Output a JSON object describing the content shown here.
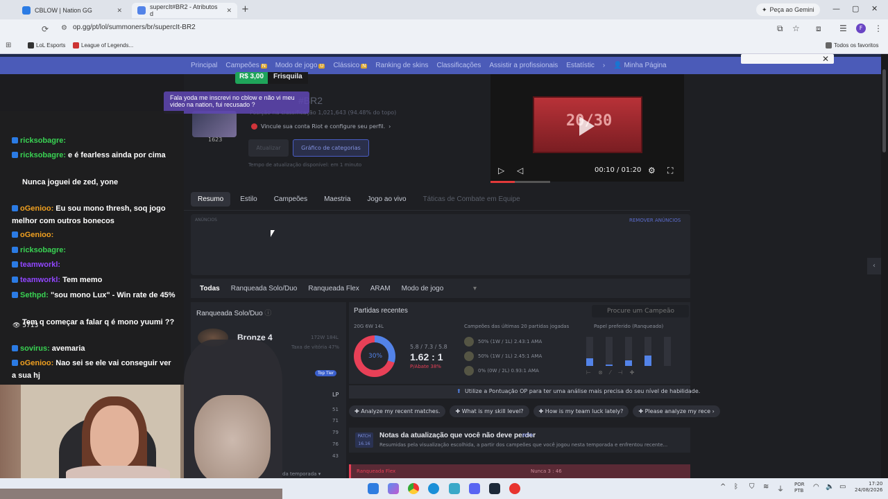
{
  "browser": {
    "tabs": [
      {
        "title": "CBLOW | Nation GG"
      },
      {
        "title": "supercIt#BR2 - Atributos d"
      }
    ],
    "new_tab": "+",
    "gemini_button": "Peça ao Gemini",
    "url": "op.gg/pt/lol/summoners/br/supercIt-BR2",
    "bookmarks": [
      "LoL Esports",
      "League of Legends..."
    ],
    "all_favorites": "Todos os favoritos",
    "profile_initial": "F"
  },
  "site_nav": {
    "items": [
      {
        "label": "Principal",
        "badge": ""
      },
      {
        "label": "Campeões",
        "badge": "N"
      },
      {
        "label": "Modo de jogo",
        "badge": "U"
      },
      {
        "label": "Clássico",
        "badge": "N"
      },
      {
        "label": "Ranking de skins",
        "badge": ""
      },
      {
        "label": "Classificações",
        "badge": ""
      },
      {
        "label": "Assistir a profissionais",
        "badge": ""
      },
      {
        "label": "Estatístic",
        "badge": ""
      }
    ],
    "my_page": "Minha Página"
  },
  "profile": {
    "name": "#BR2",
    "level": "1623",
    "ladder": "Posição na classificação 1,021,643 (94.48% do topo)",
    "riot_link": "Vincule sua conta Riot e configure seu perfil.",
    "update_button": "Atualizar",
    "graph_button": "Gráfico de categorias",
    "update_note": "Tempo de atualização disponível: em 1 minuto"
  },
  "video": {
    "screen_text": "20/30",
    "time": "00:10 / 01:20",
    "progress": 0.125
  },
  "profile_tabs": [
    "Resumo",
    "Estilo",
    "Campeões",
    "Maestria",
    "Jogo ao vivo",
    "Táticas de Combate em Equipe"
  ],
  "ads": {
    "label": "ANÚNCIOS",
    "remove": "REMOVER ANÚNCIOS"
  },
  "queue_tabs": [
    "Todas",
    "Ranqueada Solo/Duo",
    "Ranqueada Flex",
    "ARAM",
    "Modo de jogo"
  ],
  "ranked": {
    "header": "Ranqueada Solo/Duo",
    "tier": "Bronze 4",
    "lp_record": "172W 184L",
    "win_rate": "Taxa de vitória 47%",
    "top_tier": "Top Tier",
    "lp_header": "LP",
    "lp_values": [
      "51",
      "71",
      "79",
      "76",
      "43"
    ],
    "season_label": "da temporada"
  },
  "recent": {
    "header": "Partidas recentes",
    "search_placeholder": "Procure um Campeão",
    "record": "20G 6W 14L",
    "win_pct": "30%",
    "kda_line": "5.8 / 7.3 / 5.8",
    "kda_ratio": "1.62 : 1",
    "kill_participation": "P/Abate 38%",
    "champ_header": "Campeões das últimas 20 partidas jogadas",
    "champs": [
      {
        "line": "50% (1W / 1L)  2.43:1 AMA"
      },
      {
        "line": "50% (1W / 1L)  2.45:1 AMA"
      },
      {
        "line": "0% (0W / 2L)  0.93:1 AMA"
      }
    ],
    "role_header": "Papel preferido (Ranqueado)",
    "role_shares": [
      0.25,
      0.05,
      0.2,
      0.35,
      0.0
    ]
  },
  "points_bar": "Utilize a Pontuação OP para ter uma análise mais precisa do seu nível de habilidade.",
  "ai_chips": [
    "Analyze my recent matches.",
    "What is my skill level?",
    "How is my team luck lately?",
    "Please analyze my rece"
  ],
  "patch": {
    "badge": "PATCH 16.16",
    "title": "Notas da atualização que você não deve perder",
    "beta": "BETA",
    "desc": "Resumidas pela visualização escolhida, a partir dos campeões que você jogou nesta temporada e enfrentou recente..."
  },
  "match_strip": {
    "type": "Ranqueada Flex",
    "extra": "Nunca 3 : 46"
  },
  "stream": {
    "donation_amount": "R$ 3,00",
    "donation_name": "Frisquila",
    "donation_message": "Fala yoda me inscrevi no cblow e não vi meu video na nation, fui recusado ?",
    "viewers": "5713",
    "chat": [
      {
        "user": "ricksobagre:",
        "text": "",
        "color": "#39d353"
      },
      {
        "user": "ricksobagre:",
        "text": "e é fearless ainda por cima",
        "color": "#39d353"
      },
      {
        "user": "",
        "text": "Nunca joguei de zed, yone",
        "color": "#e33"
      },
      {
        "user": "oGenioo:",
        "text": "Eu sou mono thresh, soq jogo melhor com outros bonecos",
        "color": "#f0a020"
      },
      {
        "user": "oGenioo:",
        "text": "",
        "color": "#f0a020"
      },
      {
        "user": "ricksobagre:",
        "text": "",
        "color": "#39d353"
      },
      {
        "user": "teamworkl:",
        "text": "",
        "color": "#9146ff"
      },
      {
        "user": "teamworkl:",
        "text": "Tem memo",
        "color": "#9146ff"
      },
      {
        "user": "Sethpd:",
        "text": "\"sou mono Lux\" - Win rate de 45%",
        "color": "#39d353"
      },
      {
        "user": "",
        "text": "Tem q começar a falar q é mono yuumi ??",
        "color": "#e33"
      },
      {
        "user": "sovirus:",
        "text": "avemaria",
        "color": "#39d353"
      },
      {
        "user": "oGenioo:",
        "text": "Nao sei se ele vai conseguir ver a sua hj",
        "color": "#f0a020"
      }
    ]
  },
  "taskbar": {
    "lang": "POR PTB",
    "time": "17:20",
    "date": "24/08/2026"
  }
}
